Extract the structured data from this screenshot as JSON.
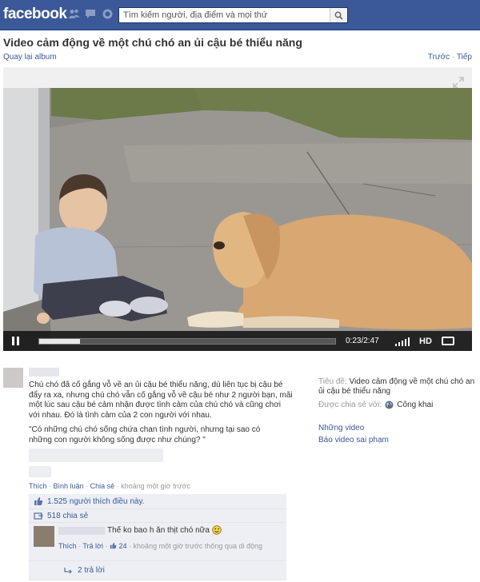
{
  "brand": {
    "logo": "facebook"
  },
  "header": {
    "search_placeholder": "Tìm kiếm người, địa điểm và mọi thứ",
    "icons": [
      "friend-requests-icon",
      "messages-icon",
      "notifications-icon",
      "search-icon"
    ]
  },
  "video_page": {
    "title": "Video cảm động về một chú chó an ủi cậu bé thiểu năng",
    "back_link": "Quay lại album",
    "prev_label": "Trước",
    "separator": "·",
    "next_label": "Tiếp"
  },
  "player": {
    "time": "0:23/2:47",
    "progress": 0.138,
    "hd_label": "HD",
    "icons": [
      "pause-icon",
      "volume-icon",
      "fullscreen-icon",
      "expand-icon"
    ]
  },
  "post": {
    "description": "Chú chó đã cố gắng vỗ về an ủi cậu bé thiểu năng, dù liên tục bị cậu bé đẩy ra xa, nhưng chú chó vẫn cố gắng vỗ về cậu bé như 2 người bạn, mãi một lúc sau cậu bé cảm nhận được tình cảm của chú chó và cũng chơi với nhau. Đó là tình cảm của 2 con người với nhau.",
    "quote": "\"Có những chú chó sống chứa chan tình người, nhưng tại sao có những con người không sống được như chúng? \"",
    "actions": {
      "like": "Thích",
      "comment": "Bình luận",
      "share": "Chia sẻ",
      "dot": "·",
      "time": "khoảng một giờ trước"
    }
  },
  "ufi": {
    "likes": "1.525 người thích điều này.",
    "shares": "518 chia sẻ",
    "comment": {
      "text": "Thế ko bao h ăn thịt chó nữa",
      "like": "Thích",
      "reply": "Trả lời",
      "like_count": "24",
      "meta": "khoảng một giờ trước thông qua di động",
      "dot": "·"
    },
    "replies": "2 trả lời"
  },
  "sidebar": {
    "title_label": "Tiêu đề:",
    "title_value": "Video cảm động về một chú chó an ủi cậu bé thiểu năng",
    "shared_label": "Được chia sẻ với:",
    "privacy_value": "Công khai",
    "links": [
      "Những video",
      "Báo video sai phạm"
    ]
  }
}
